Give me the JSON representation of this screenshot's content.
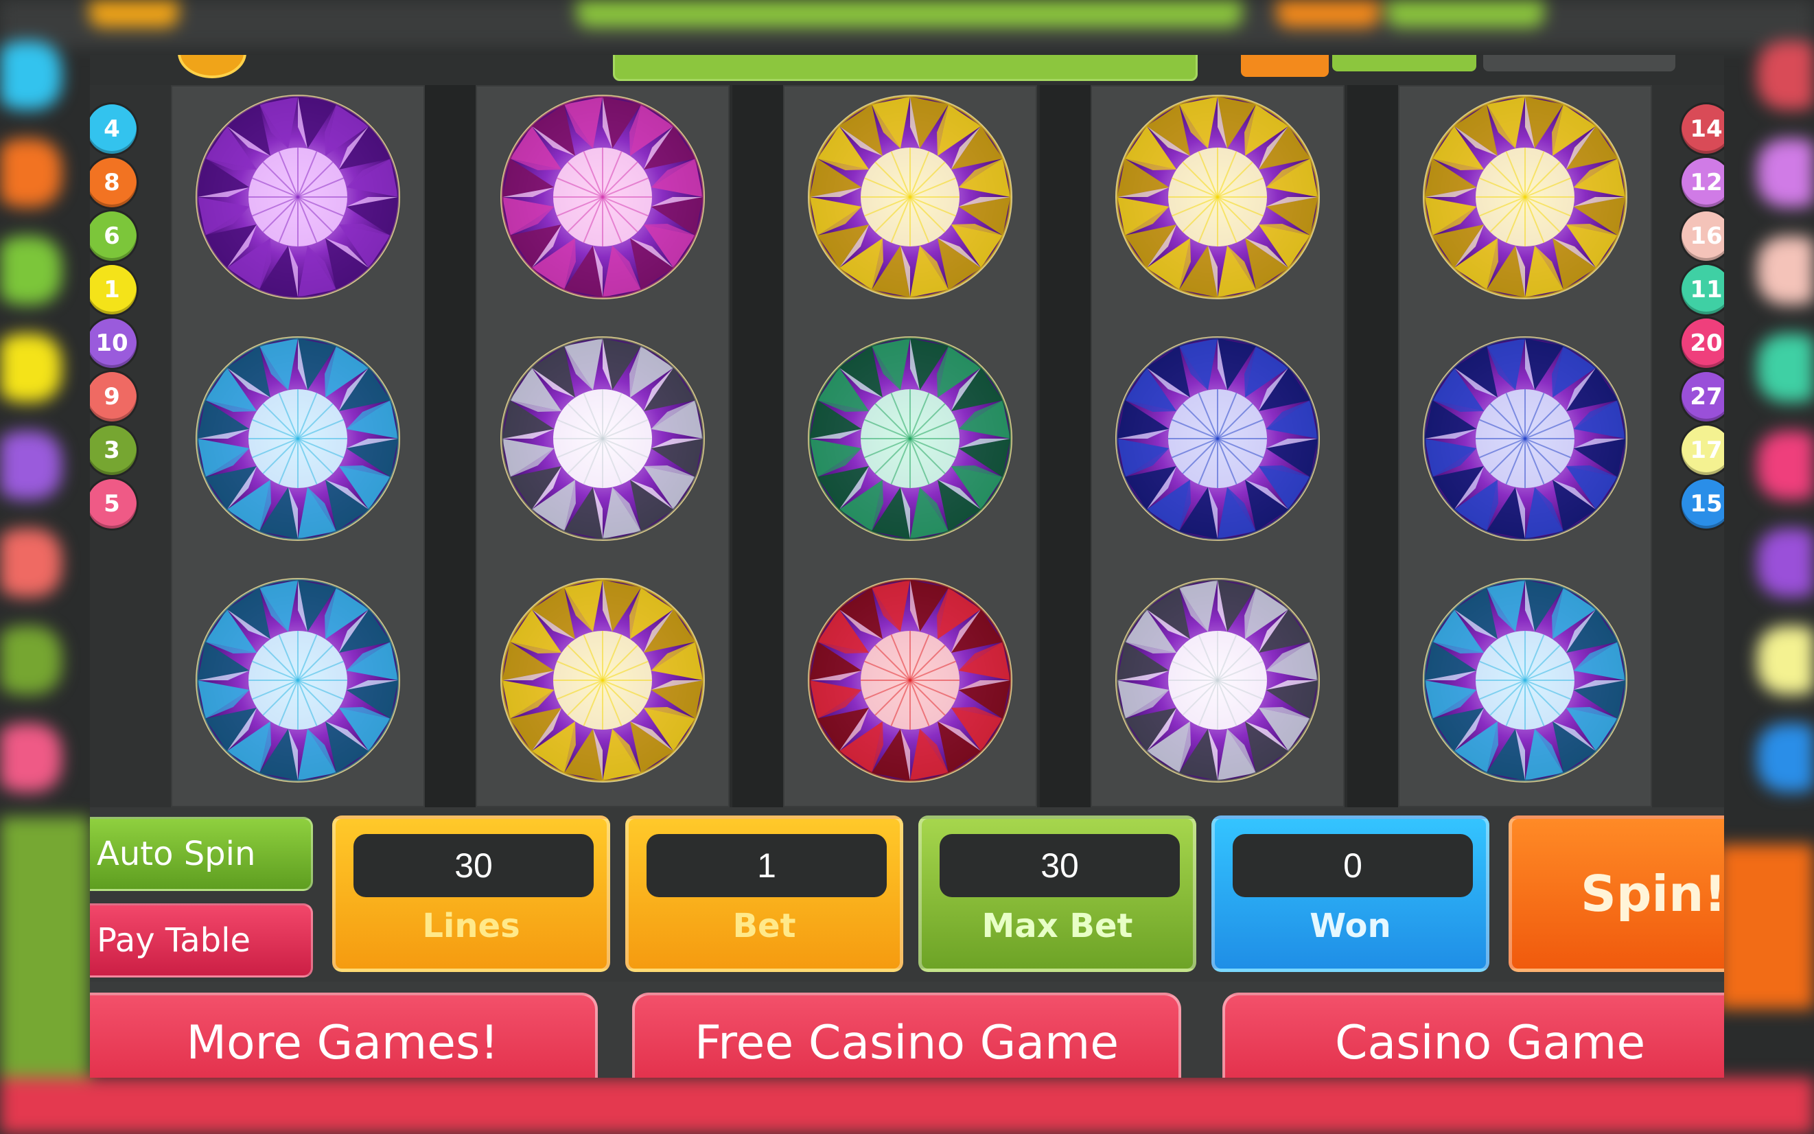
{
  "line_numbers_left": [
    {
      "label": "4",
      "color": "#33c3ee"
    },
    {
      "label": "8",
      "color": "#f27322"
    },
    {
      "label": "6",
      "color": "#7cc63a"
    },
    {
      "label": "1",
      "color": "#f4e319"
    },
    {
      "label": "10",
      "color": "#9a5bdc"
    },
    {
      "label": "9",
      "color": "#ef6a63"
    },
    {
      "label": "3",
      "color": "#76a631"
    },
    {
      "label": "5",
      "color": "#ef5a86"
    }
  ],
  "line_numbers_right": [
    {
      "label": "14",
      "color": "#d94b57"
    },
    {
      "label": "12",
      "color": "#d07be6"
    },
    {
      "label": "16",
      "color": "#f4c3b9"
    },
    {
      "label": "11",
      "color": "#3fd0a4"
    },
    {
      "label": "20",
      "color": "#ef3f7c"
    },
    {
      "label": "27",
      "color": "#9a50d9"
    },
    {
      "label": "17",
      "color": "#f4f291"
    },
    {
      "label": "15",
      "color": "#2a8ee8"
    }
  ],
  "reels": [
    [
      "purple",
      "cyan",
      "cyan"
    ],
    [
      "pink",
      "white",
      "yellow"
    ],
    [
      "yellow",
      "green",
      "red"
    ],
    [
      "yellow",
      "blue",
      "white"
    ],
    [
      "yellow",
      "blue",
      "cyan"
    ]
  ],
  "gem_colors": {
    "purple": {
      "base": "#8a2dc2",
      "light": "#f0c3ff",
      "dark": "#4a0f7a"
    },
    "pink": {
      "base": "#d33ab0",
      "light": "#ffd4f4",
      "dark": "#7d1063"
    },
    "yellow": {
      "base": "#f5d80c",
      "light": "#fffbc4",
      "dark": "#c9a300"
    },
    "cyan": {
      "base": "#2fb7e4",
      "light": "#d4f7ff",
      "dark": "#0c5a78"
    },
    "white": {
      "base": "#c9d3d8",
      "light": "#ffffff",
      "dark": "#3c4448"
    },
    "green": {
      "base": "#1ea35b",
      "light": "#cfffe4",
      "dark": "#075a2b"
    },
    "red": {
      "base": "#e2262a",
      "light": "#ffd0cc",
      "dark": "#7f0b0d"
    },
    "blue": {
      "base": "#2644c8",
      "light": "#d6defc",
      "dark": "#0c1a6e"
    }
  },
  "controls": {
    "auto_spin": "Auto Spin",
    "pay_table": "Pay Table",
    "lines": {
      "value": "30",
      "label": "Lines"
    },
    "bet": {
      "value": "1",
      "label": "Bet"
    },
    "max_bet": {
      "value": "30",
      "label": "Max Bet"
    },
    "won": {
      "value": "0",
      "label": "Won"
    },
    "spin": "Spin!"
  },
  "promos": {
    "more_games": "More Games!",
    "free_casino_game": "Free Casino Game",
    "casino_game": "Casino Game"
  }
}
